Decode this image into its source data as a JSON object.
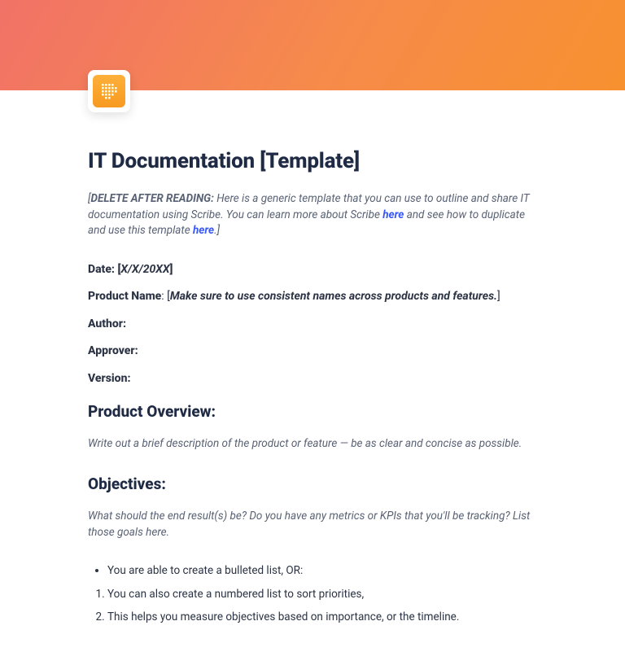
{
  "header": {
    "icon_name": "grid-icon"
  },
  "title": "IT Documentation [Template]",
  "intro": {
    "prefix_bracket": "[",
    "delete_after_reading": "DELETE AFTER READING:",
    "body_1": " Here is a generic template that you can use to outline and share IT documentation using Scribe. You can learn more about Scribe ",
    "link_1": "here",
    "body_2": " and see how to duplicate and use this template ",
    "link_2": "here",
    "suffix": ".]"
  },
  "fields": {
    "date_label": "Date:  [",
    "date_value": "X/X/20XX",
    "date_close": "]",
    "product_label": "Product Name",
    "product_brackets": ": [",
    "product_note": "Make sure to use consistent names across products and features.",
    "product_close": "]",
    "author_label": "Author:",
    "approver_label": "Approver:",
    "version_label": "Version:"
  },
  "overview": {
    "heading": "Product Overview:",
    "desc": "Write out a brief description of the product or feature —  be as clear and concise as possible."
  },
  "objectives": {
    "heading": "Objectives:",
    "desc": "What should the end result(s) be? Do you have any metrics or KPIs that you'll be tracking? List those goals here.",
    "bullets": [
      "You are able to create a bulleted list, OR:"
    ],
    "numbers": [
      "You can also create a numbered list to sort priorities,",
      "This helps you measure objectives based on importance, or the timeline."
    ]
  }
}
